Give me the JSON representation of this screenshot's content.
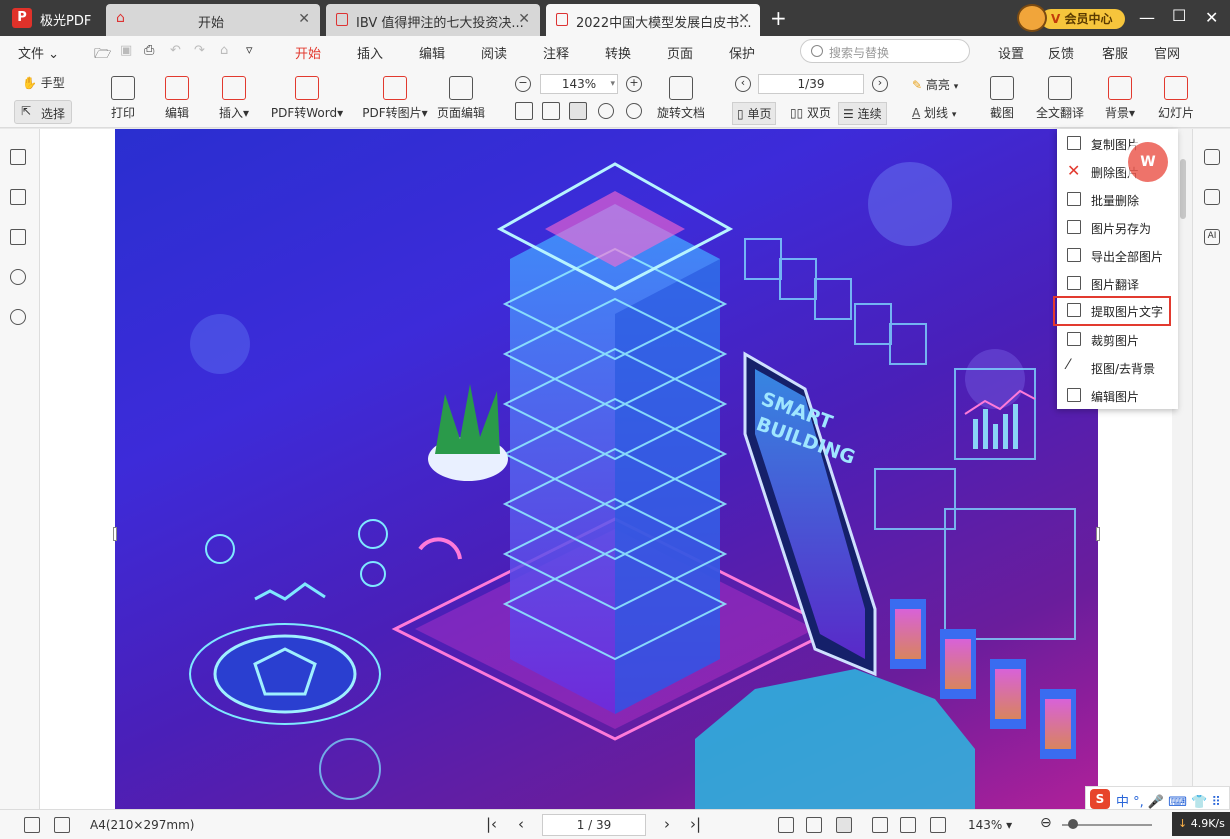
{
  "app": {
    "name": "极光PDF",
    "logo_letter": "P"
  },
  "tabs": [
    {
      "label": "开始"
    },
    {
      "label": "IBV 值得押注的七大投资决..."
    },
    {
      "label": "2022中国大模型发展白皮书..."
    }
  ],
  "vip": {
    "label": "会员中心",
    "badge": "V"
  },
  "menu": {
    "file": "文件",
    "items": [
      "开始",
      "插入",
      "编辑",
      "阅读",
      "注释",
      "转换",
      "页面",
      "保护"
    ],
    "search_placeholder": "搜索与替换",
    "right": [
      "设置",
      "反馈",
      "客服",
      "官网"
    ]
  },
  "toolbar": {
    "hand": "手型",
    "select": "选择",
    "print": "打印",
    "edit": "编辑",
    "insert": "插入▾",
    "pdf_word": "PDF转Word▾",
    "pdf_img": "PDF转图片▾",
    "page_edit": "页面编辑",
    "zoom": "143%",
    "rotate_doc": "旋转文档",
    "page_indicator": "1/39",
    "single": "单页",
    "double": "双页",
    "continuous": "连续",
    "highlight": "高亮",
    "strikethrough": "划线",
    "screenshot": "截图",
    "translate": "全文翻译",
    "background": "背景▾",
    "slideshow": "幻灯片"
  },
  "context_menu": {
    "items": [
      {
        "label": "复制图片",
        "icon": "copy-icon"
      },
      {
        "label": "删除图片",
        "icon": "close-icon"
      },
      {
        "label": "批量删除",
        "icon": "batch-delete-icon"
      },
      {
        "label": "图片另存为",
        "icon": "save-icon"
      },
      {
        "label": "导出全部图片",
        "icon": "export-icon"
      },
      {
        "label": "图片翻译",
        "icon": "translate-icon"
      },
      {
        "label": "提取图片文字",
        "icon": "ocr-icon"
      },
      {
        "label": "裁剪图片",
        "icon": "crop-icon"
      },
      {
        "label": "抠图/去背景",
        "icon": "wand-icon"
      },
      {
        "label": "编辑图片",
        "icon": "image-edit-icon"
      }
    ],
    "highlighted_index": 6
  },
  "w_badge": "W",
  "doc_image_text": {
    "smart": "SMART",
    "building": "BUILDING"
  },
  "statusbar": {
    "paper_size": "A4(210×297mm)",
    "page": "1 / 39",
    "zoom": "143%"
  },
  "ime": {
    "logo": "S",
    "text": "中 °, 🎤 ⌨ 👕 ⠿"
  },
  "net_speed": "4.9K/s",
  "colors": {
    "accent": "#e23a2f",
    "titlebar": "#3b3b3b",
    "vip": "#f6c53c"
  }
}
